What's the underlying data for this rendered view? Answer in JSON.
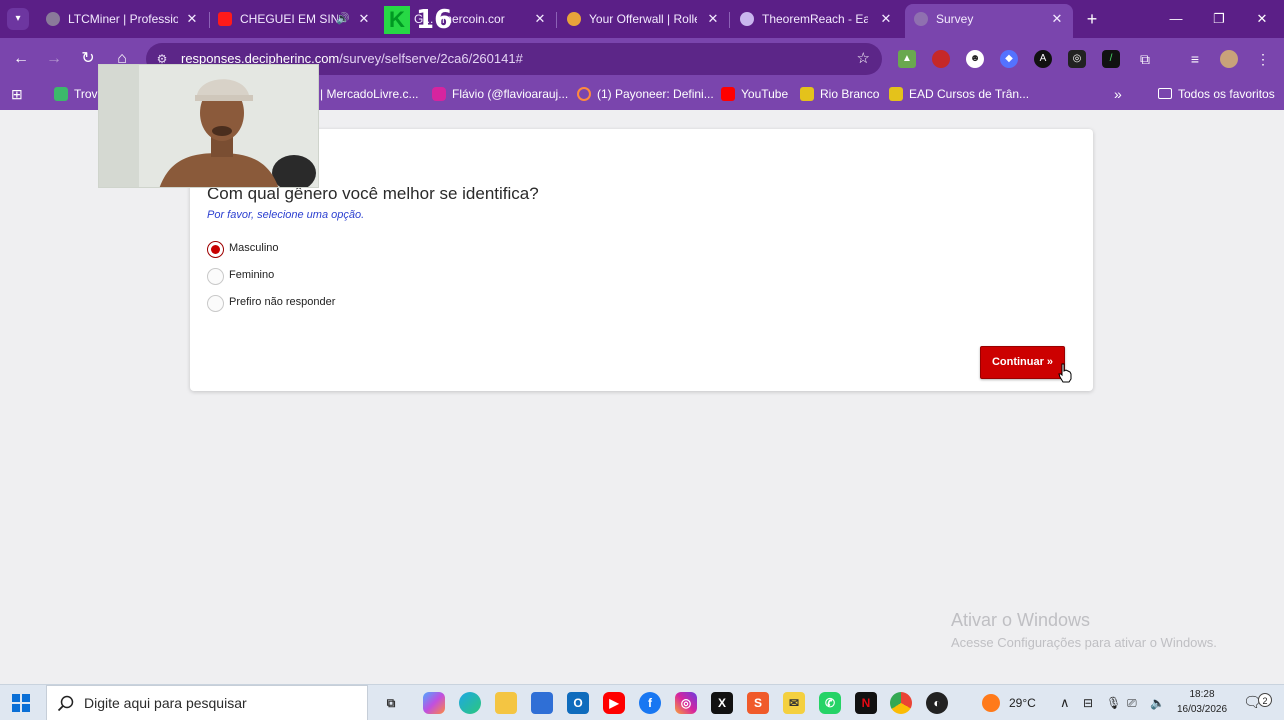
{
  "browser": {
    "tabs": [
      {
        "title": "LTCMiner | Profession",
        "active": false
      },
      {
        "title": "CHEGUEI EM SIN",
        "active": false
      },
      {
        "title": "G... limercoin.cor",
        "active": false
      },
      {
        "title": "Your Offerwall | Rolle",
        "active": false
      },
      {
        "title": "TheoremReach - Earn",
        "active": false
      },
      {
        "title": "Survey",
        "active": true
      }
    ],
    "tab_overlay_text": "16",
    "tab_overlay_letter": "K",
    "url_host": "responses.decipherinc.com",
    "url_path": "/survey/selfserve/2ca6/260141#"
  },
  "bookmarks": {
    "items": [
      "Trov",
      "| MercadoLivre.c...",
      "Flávio (@flavioarauj...",
      "(1) Payoneer: Defini...",
      "YouTube",
      "Rio Branco",
      "EAD Cursos de Trân..."
    ],
    "overflow": "»",
    "all_favorites": "Todos os favoritos"
  },
  "survey": {
    "question": "Com qual gênero você melhor se identifica?",
    "instruction": "Por favor, selecione uma opção.",
    "options": [
      {
        "label": "Masculino",
        "selected": true
      },
      {
        "label": "Feminino",
        "selected": false
      },
      {
        "label": "Prefiro não responder",
        "selected": false
      }
    ],
    "continue_label": "Continuar »"
  },
  "watermark": {
    "line1": "Ativar o Windows",
    "line2": "Acesse Configurações para ativar o Windows."
  },
  "taskbar": {
    "search_placeholder": "Digite aqui para pesquisar",
    "temperature": "29°C",
    "time": "18:28",
    "date": "16/03/2026",
    "notification_count": "2"
  },
  "colors": {
    "chrome_dark": "#5b1f87",
    "chrome_light": "#7a45ad",
    "accent_red": "#cc0000",
    "instruction_blue": "#2b3fd0"
  }
}
